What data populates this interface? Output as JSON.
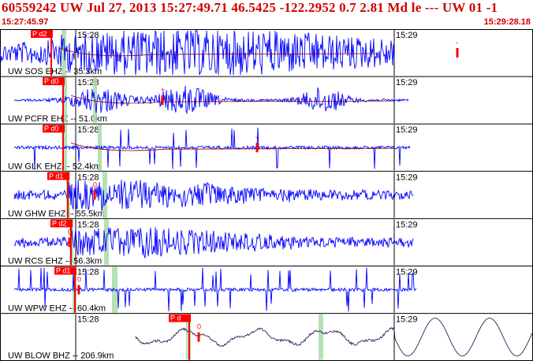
{
  "header": {
    "title": "60559242  UW Jul 27, 2013 15:27:49.71    46.5425 -122.2952   0.7 2.81 Md le ---  UW 01   -1",
    "start_time": "15:27:45.97",
    "end_time": "15:29:28.18"
  },
  "colors": {
    "header_text": "#d00000",
    "trace": "#0000ff",
    "trace_last": "#3a1a5a",
    "pick_box": "#ff0000",
    "tick_line": "#000000",
    "green_band": "#a8dca8",
    "theory_curve": "#8b0000"
  },
  "tick_labels": {
    "first": "15:28",
    "second": "15:29"
  },
  "pick_label": "P d2",
  "pick_label_short": "P d0",
  "pick_label_alt": "P d",
  "pick_sub": "P",
  "amp_mark": "0",
  "minus_mark": "-",
  "plus_mark": "+",
  "channels": [
    {
      "label": "UW SOS EHZ -- 35.3km",
      "pick_text": "P d2",
      "style": "noisy"
    },
    {
      "label": "UW PCFR EHZ -- 51.0km",
      "pick_text": "P d0",
      "style": "bursts"
    },
    {
      "label": "UW GLK EHZ -- 52.4km",
      "pick_text": "P d0",
      "style": "spikes"
    },
    {
      "label": "UW GHW EHZ -- 55.5km",
      "pick_text": "P d1",
      "style": "noisy"
    },
    {
      "label": "UW RCS EHZ -- 56.3km",
      "pick_text": "P d2",
      "style": "noisy"
    },
    {
      "label": "UW WPW EHZ -- 60.4km",
      "pick_text": "P d1",
      "style": "spikes"
    },
    {
      "label": "UW BLOW BHZ -- 206.9km",
      "pick_text": "P d",
      "style": "waves"
    }
  ]
}
